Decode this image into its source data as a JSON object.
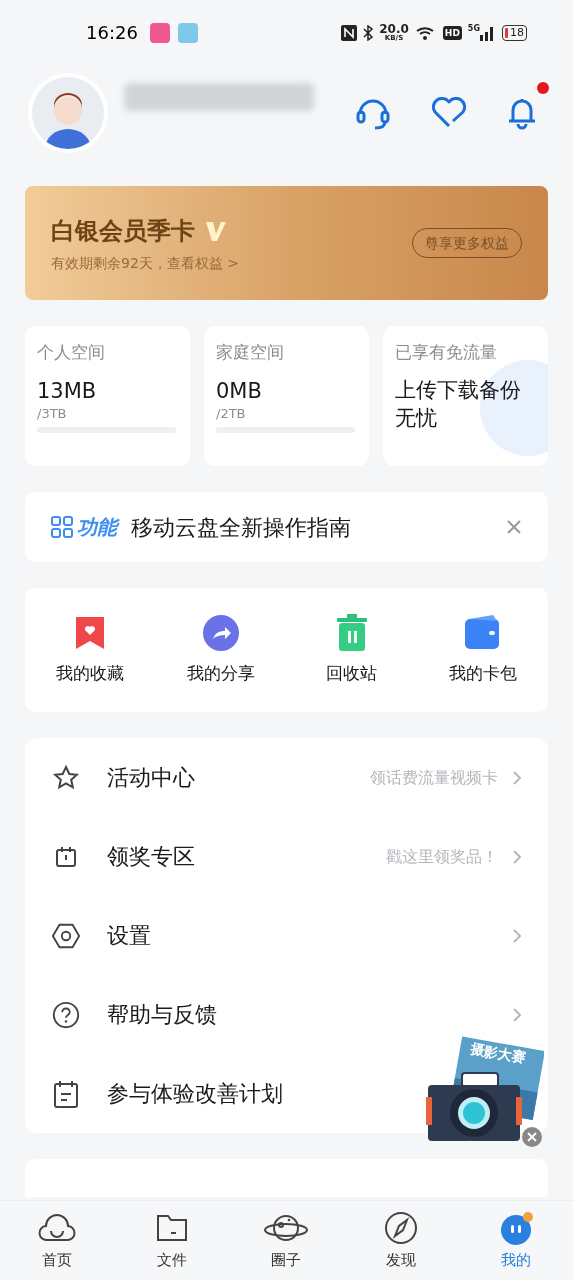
{
  "status_bar": {
    "time": "16:26",
    "net_speed": "20.0",
    "net_unit": "KB/S",
    "hd": "HD",
    "net_type": "5G",
    "battery": "18"
  },
  "header": {
    "notification_dot": true
  },
  "membership": {
    "title": "白银会员季卡",
    "subtitle": "有效期剩余92天，查看权益 >",
    "button": "尊享更多权益"
  },
  "storage": [
    {
      "kind": "quota",
      "label": "个人空间",
      "used": "13MB",
      "total": "/3TB"
    },
    {
      "kind": "quota",
      "label": "家庭空间",
      "used": "0MB",
      "total": "/2TB"
    },
    {
      "kind": "promo",
      "label": "已享有免流量",
      "text": "上传下载备份无忧"
    }
  ],
  "guide": {
    "tag": "功能",
    "text": "移动云盘全新操作指南"
  },
  "quick_actions": [
    {
      "kind": "bookmark",
      "label": "我的收藏"
    },
    {
      "kind": "share",
      "label": "我的分享"
    },
    {
      "kind": "trash",
      "label": "回收站"
    },
    {
      "kind": "wallet",
      "label": "我的卡包"
    }
  ],
  "menu": [
    {
      "kind": "star",
      "label": "活动中心",
      "hint": "领话费流量视频卡",
      "chevron": true
    },
    {
      "kind": "prize",
      "label": "领奖专区",
      "hint": "戳这里领奖品！",
      "chevron": true
    },
    {
      "kind": "settings",
      "label": "设置",
      "chevron": true
    },
    {
      "kind": "help",
      "label": "帮助与反馈",
      "chevron": true
    },
    {
      "kind": "plan",
      "label": "参与体验改善计划",
      "chevron": false
    }
  ],
  "floating_promo": {
    "label": "摄影大赛"
  },
  "tab_bar": [
    {
      "kind": "home",
      "label": "首页",
      "selected": false
    },
    {
      "kind": "files",
      "label": "文件",
      "selected": false
    },
    {
      "kind": "circle",
      "label": "圈子",
      "selected": false
    },
    {
      "kind": "discover",
      "label": "发现",
      "selected": false
    },
    {
      "kind": "mine",
      "label": "我的",
      "selected": true
    }
  ]
}
